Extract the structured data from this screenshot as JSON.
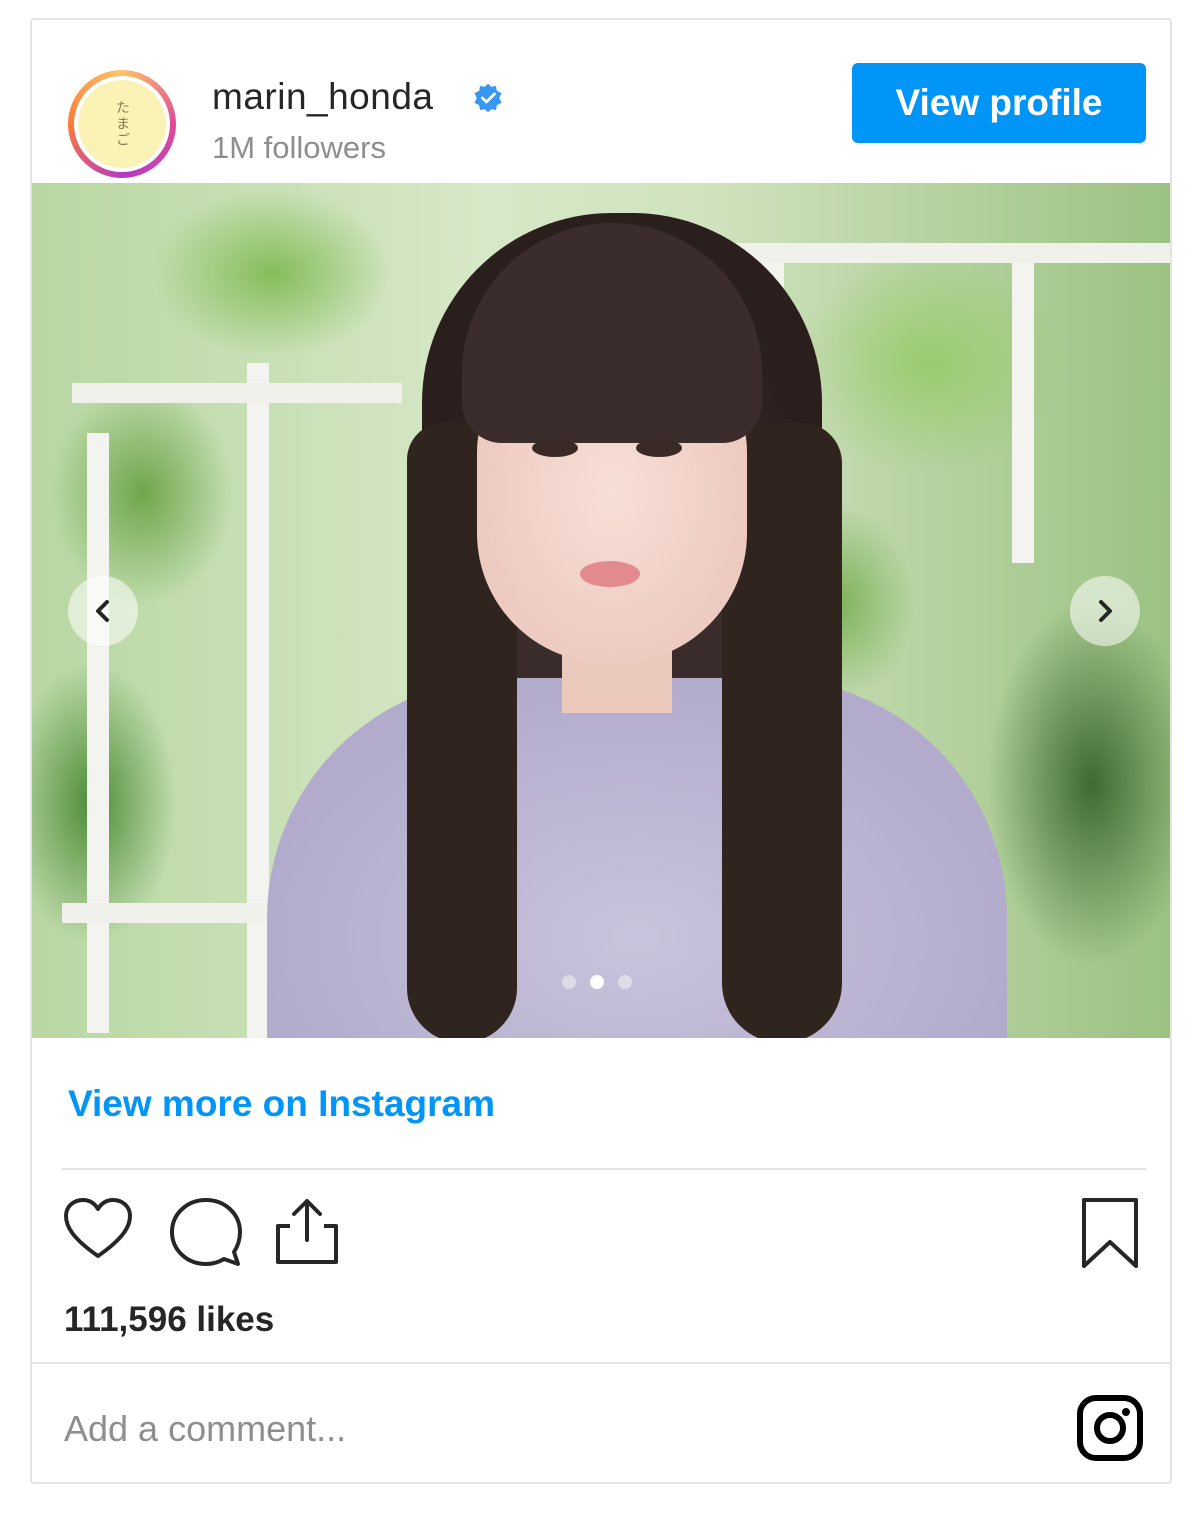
{
  "header": {
    "username": "marin_honda",
    "followers": "1M followers",
    "view_profile_label": "View profile",
    "avatar_text": "たまご",
    "verified_icon": "verified-badge-icon",
    "verified_color": "#3897f0"
  },
  "post": {
    "carousel": {
      "slide_count": 3,
      "active_index": 1
    },
    "prev_icon": "chevron-left-icon",
    "next_icon": "chevron-right-icon"
  },
  "footer": {
    "view_more_label": "View more on Instagram",
    "likes": "111,596 likes",
    "comment_placeholder": "Add a comment...",
    "icons": [
      "heart-icon",
      "comment-icon",
      "share-icon",
      "bookmark-icon",
      "instagram-logo-icon"
    ]
  },
  "colors": {
    "accent": "#0095f6",
    "text": "#262626",
    "muted": "#8e8e8e",
    "border": "#e3e3e3"
  }
}
